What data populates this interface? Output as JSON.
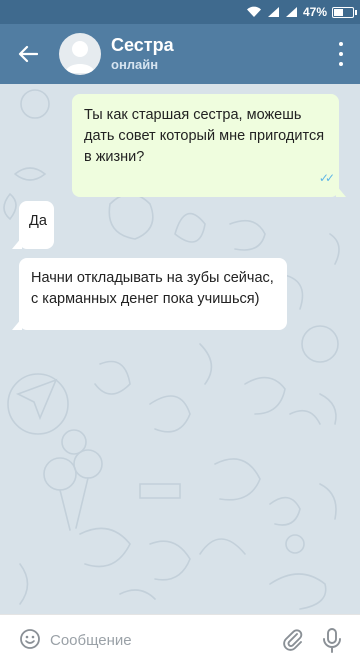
{
  "status_bar": {
    "battery_text": "47%",
    "battery_level": 0.47,
    "icons": [
      "wifi-icon",
      "signal-icon",
      "signal-icon",
      "battery-icon"
    ]
  },
  "header": {
    "title": "Сестра",
    "subtitle": "онлайн",
    "icons": [
      "back-arrow-icon",
      "avatar-placeholder-icon",
      "more-vertical-icon"
    ],
    "colors": {
      "appbar": "#517da2",
      "statusbar": "#3f6a8e"
    }
  },
  "messages": [
    {
      "direction": "out",
      "text": "Ты как старшая сестра, можешь дать совет который мне пригодится в жизни?",
      "status": "read"
    },
    {
      "direction": "in",
      "text": "Да"
    },
    {
      "direction": "in",
      "text": "Начни откладывать на зубы сейчас, с карманных денег пока учишься)"
    }
  ],
  "composer": {
    "placeholder": "Сообщение",
    "icons": [
      "emoji-icon",
      "paperclip-icon",
      "microphone-icon"
    ]
  },
  "colors": {
    "outgoing_bubble": "#effdde",
    "incoming_bubble": "#ffffff",
    "chat_background": "#d8e2e9",
    "read_checks": "#5fb6e6"
  }
}
